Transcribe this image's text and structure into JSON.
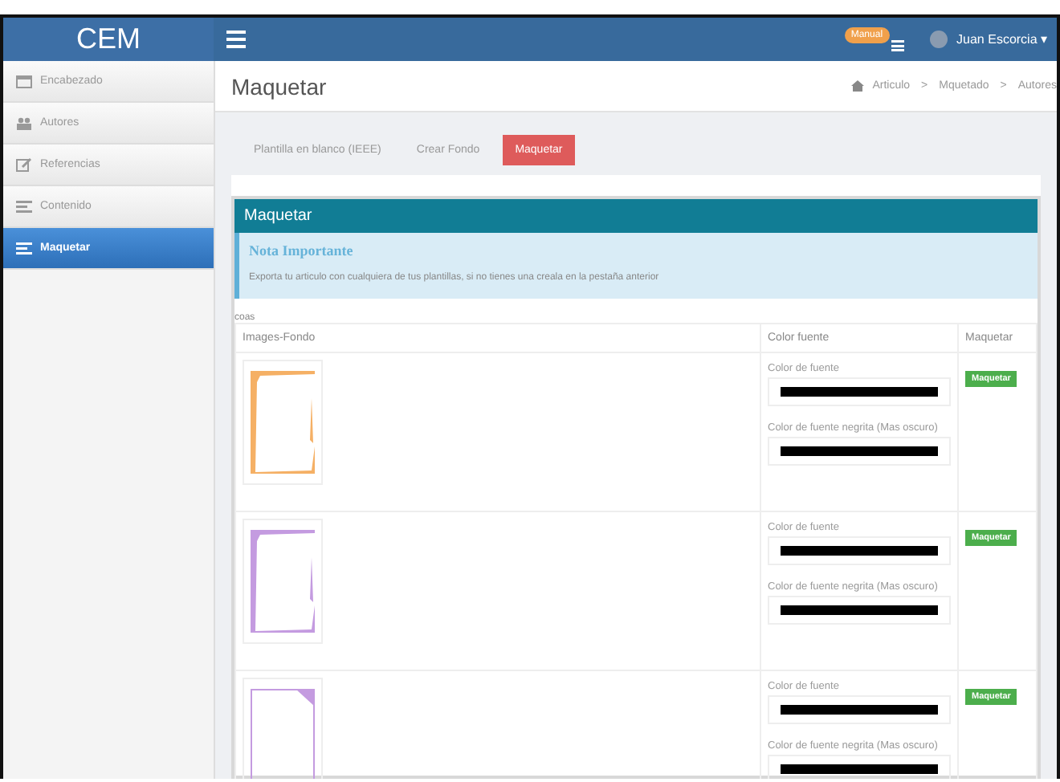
{
  "brand": "CEM",
  "top_bar": {
    "badge": "Manual",
    "user": "Juan Escorcia ▾"
  },
  "sidebar": {
    "items": [
      {
        "label": "Encabezado",
        "kind": "calendar",
        "selected": false
      },
      {
        "label": "Autores",
        "kind": "users",
        "selected": false
      },
      {
        "label": "Referencias",
        "kind": "edit",
        "selected": false
      },
      {
        "label": "Contenido",
        "kind": "list",
        "selected": false
      },
      {
        "label": "Maquetar",
        "kind": "list",
        "selected": true
      }
    ]
  },
  "page_title": "Maquetar",
  "breadcrumb": [
    "Articulo",
    "Mquetado",
    "Autores"
  ],
  "breadcrumb_separator": ">",
  "tabs": [
    {
      "label": "Plantilla en blanco (IEEE)",
      "selected": false
    },
    {
      "label": "Crear Fondo",
      "selected": false
    },
    {
      "label": "Maquetar",
      "selected": true
    }
  ],
  "panel": {
    "title": "Maquetar",
    "note_title": "Nota Importante",
    "note_text": "Exporta tu articulo con cualquiera de tus plantillas, si no tienes una creala en la pestaña anterior",
    "caption": "coas",
    "columns": [
      "Images-Fondo",
      "Color fuente",
      "Maquetar"
    ],
    "rows": [
      {
        "kind": "grunge",
        "color": "#f5b065",
        "font_label": "Color de fuente",
        "bold_label": "Color de fuente negrita (Mas oscuro)",
        "button": "Maquetar"
      },
      {
        "kind": "grunge",
        "color": "#c49be0",
        "font_label": "Color de fuente",
        "bold_label": "Color de fuente negrita (Mas oscuro)",
        "button": "Maquetar"
      },
      {
        "kind": "corner",
        "color": "#c49be0",
        "font_label": "Color de fuente",
        "bold_label": "Color de fuente negrita (Mas oscuro)",
        "button": "Maquetar"
      }
    ]
  }
}
